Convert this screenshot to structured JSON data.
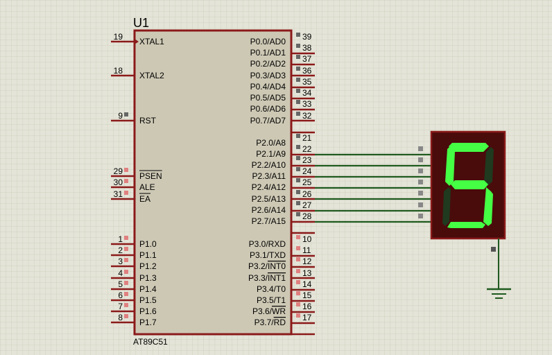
{
  "chip": {
    "ref": "U1",
    "part": "AT89C51",
    "left_pins": [
      {
        "num": "19",
        "label": "XTAL1",
        "overbar": false
      },
      {
        "num": "18",
        "label": "XTAL2",
        "overbar": false
      },
      {
        "num": "9",
        "label": "RST",
        "overbar": false
      },
      {
        "num": "29",
        "label": "PSEN",
        "overbar": true
      },
      {
        "num": "30",
        "label": "ALE",
        "overbar": false
      },
      {
        "num": "31",
        "label": "EA",
        "overbar": true
      },
      {
        "num": "1",
        "label": "P1.0",
        "overbar": false
      },
      {
        "num": "2",
        "label": "P1.1",
        "overbar": false
      },
      {
        "num": "3",
        "label": "P1.2",
        "overbar": false
      },
      {
        "num": "4",
        "label": "P1.3",
        "overbar": false
      },
      {
        "num": "5",
        "label": "P1.4",
        "overbar": false
      },
      {
        "num": "6",
        "label": "P1.5",
        "overbar": false
      },
      {
        "num": "7",
        "label": "P1.6",
        "overbar": false
      },
      {
        "num": "8",
        "label": "P1.7",
        "overbar": false
      }
    ],
    "right_pins": [
      {
        "num": "39",
        "label": "P0.0/AD0"
      },
      {
        "num": "38",
        "label": "P0.1/AD1"
      },
      {
        "num": "37",
        "label": "P0.2/AD2"
      },
      {
        "num": "36",
        "label": "P0.3/AD3"
      },
      {
        "num": "35",
        "label": "P0.4/AD4"
      },
      {
        "num": "34",
        "label": "P0.5/AD5"
      },
      {
        "num": "33",
        "label": "P0.6/AD6"
      },
      {
        "num": "32",
        "label": "P0.7/AD7"
      },
      {
        "num": "21",
        "label": "P2.0/A8"
      },
      {
        "num": "22",
        "label": "P2.1/A9"
      },
      {
        "num": "23",
        "label": "P2.2/A10"
      },
      {
        "num": "24",
        "label": "P2.3/A11"
      },
      {
        "num": "25",
        "label": "P2.4/A12"
      },
      {
        "num": "26",
        "label": "P2.5/A13"
      },
      {
        "num": "27",
        "label": "P2.6/A14"
      },
      {
        "num": "28",
        "label": "P2.7/A15"
      },
      {
        "num": "10",
        "label": "P3.0/RXD"
      },
      {
        "num": "11",
        "label": "P3.1/TXD"
      },
      {
        "num": "12",
        "label": "P3.2/",
        "bar": "INT0"
      },
      {
        "num": "13",
        "label": "P3.3/",
        "bar": "INT1"
      },
      {
        "num": "14",
        "label": "P3.4/T0"
      },
      {
        "num": "15",
        "label": "P3.5/T1"
      },
      {
        "num": "16",
        "label": "P3.6/",
        "bar": "WR"
      },
      {
        "num": "17",
        "label": "P3.7/",
        "bar": "RD"
      }
    ]
  },
  "display": {
    "digit": "5",
    "segments_on": [
      "a",
      "f",
      "g",
      "c",
      "d"
    ]
  },
  "colors": {
    "background": "#e4e4d8",
    "grid": "#cfcfc0",
    "chip_fill": "#cdc8b4",
    "chip_border": "#8b1a1a",
    "wire": "#1f5a1f",
    "segment_on": "#44ff44",
    "segment_off": "#1f3a1f",
    "display_fill": "#4a0b0b"
  }
}
